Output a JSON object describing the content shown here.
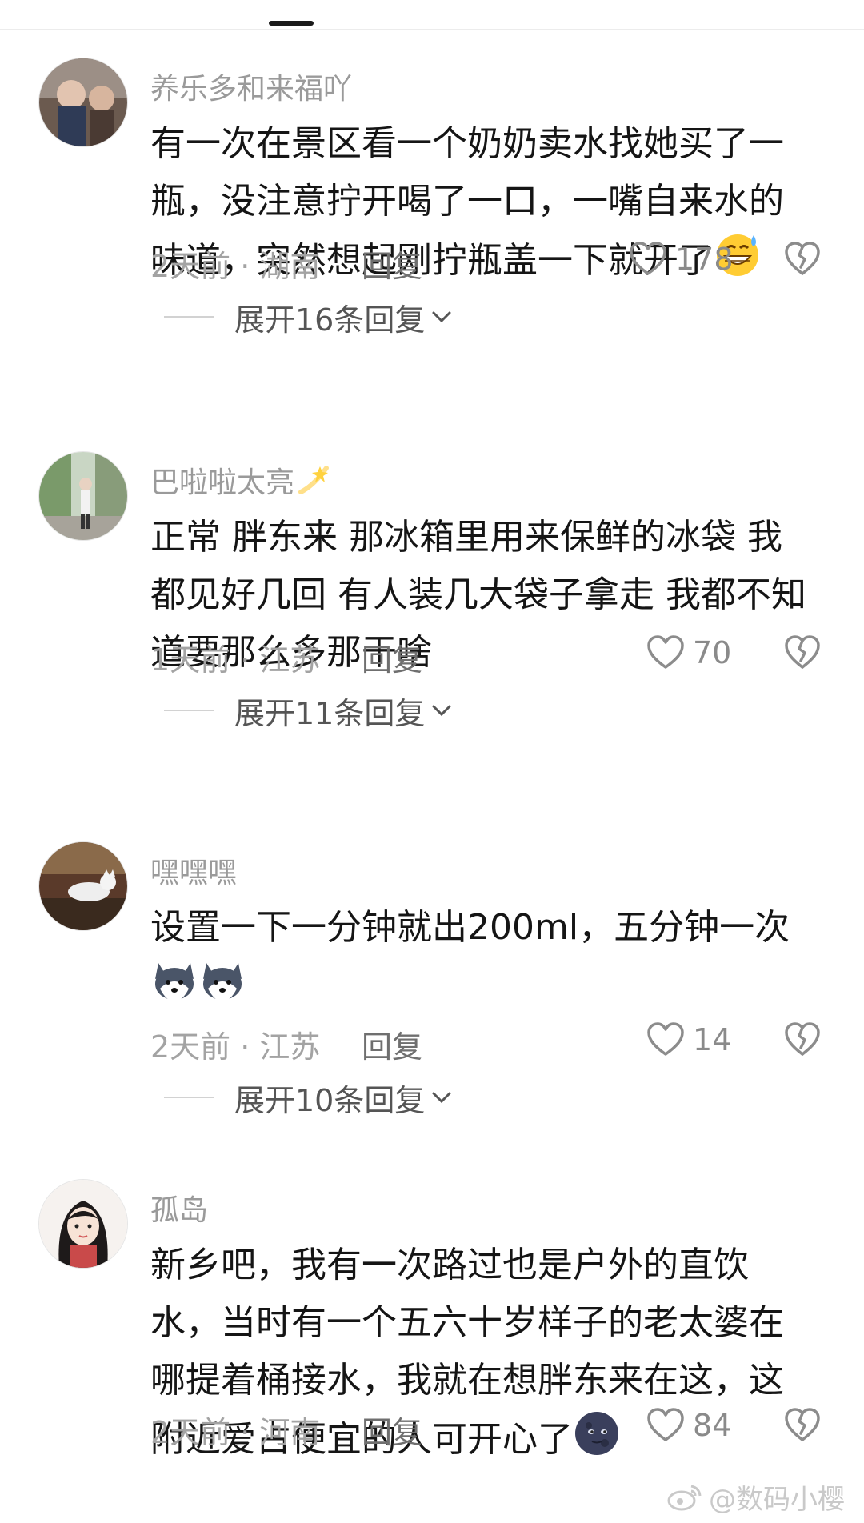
{
  "comments": [
    {
      "username": "养乐多和来福吖",
      "text_lines": [
        "有一次在景区看一个奶奶卖水找她买了一",
        "瓶，没注意拧开喝了一口，一嘴自来水的",
        "味道，突然想起刚拧瓶盖一下就开了"
      ],
      "trailing_emoji": "grinning-sweat-emoji",
      "meta": "2天前 · 湖南",
      "reply_label": "回复",
      "likes": "178",
      "expand_label": "展开16条回复"
    },
    {
      "username": "巴啦啦太亮",
      "username_emoji": "sparkle-emoji",
      "text_lines": [
        "正常 胖东来 那冰箱里用来保鲜的冰袋 我",
        "都见好几回 有人装几大袋子拿走 我都不知",
        "道要那么多那干啥"
      ],
      "meta": "1天前 · 江苏",
      "reply_label": "回复",
      "likes": "70",
      "expand_label": "展开11条回复"
    },
    {
      "username": "嘿嘿嘿",
      "text_lines": [
        "设置一下一分钟就出200ml，五分钟一次"
      ],
      "sticker_emojis": [
        "husky-dog-emoji",
        "husky-dog-emoji"
      ],
      "meta": "2天前 · 江苏",
      "reply_label": "回复",
      "likes": "14",
      "expand_label": "展开10条回复"
    },
    {
      "username": "孤岛",
      "text_lines": [
        "新乡吧，我有一次路过也是户外的直饮",
        "水，当时有一个五六十岁样子的老太婆在",
        "哪提着桶接水，我就在想胖东来在这，这",
        "附近爱占便宜的人可开心了"
      ],
      "trailing_emoji": "new-moon-face-emoji",
      "meta": "2天前 · 河南",
      "reply_label": "回复",
      "likes": "84"
    }
  ],
  "watermark": "@数码小樱",
  "colors": {
    "username": "#9a9a9a",
    "content": "#151515",
    "meta": "#a3a3a3",
    "icon_outline": "#8c8c8c"
  }
}
